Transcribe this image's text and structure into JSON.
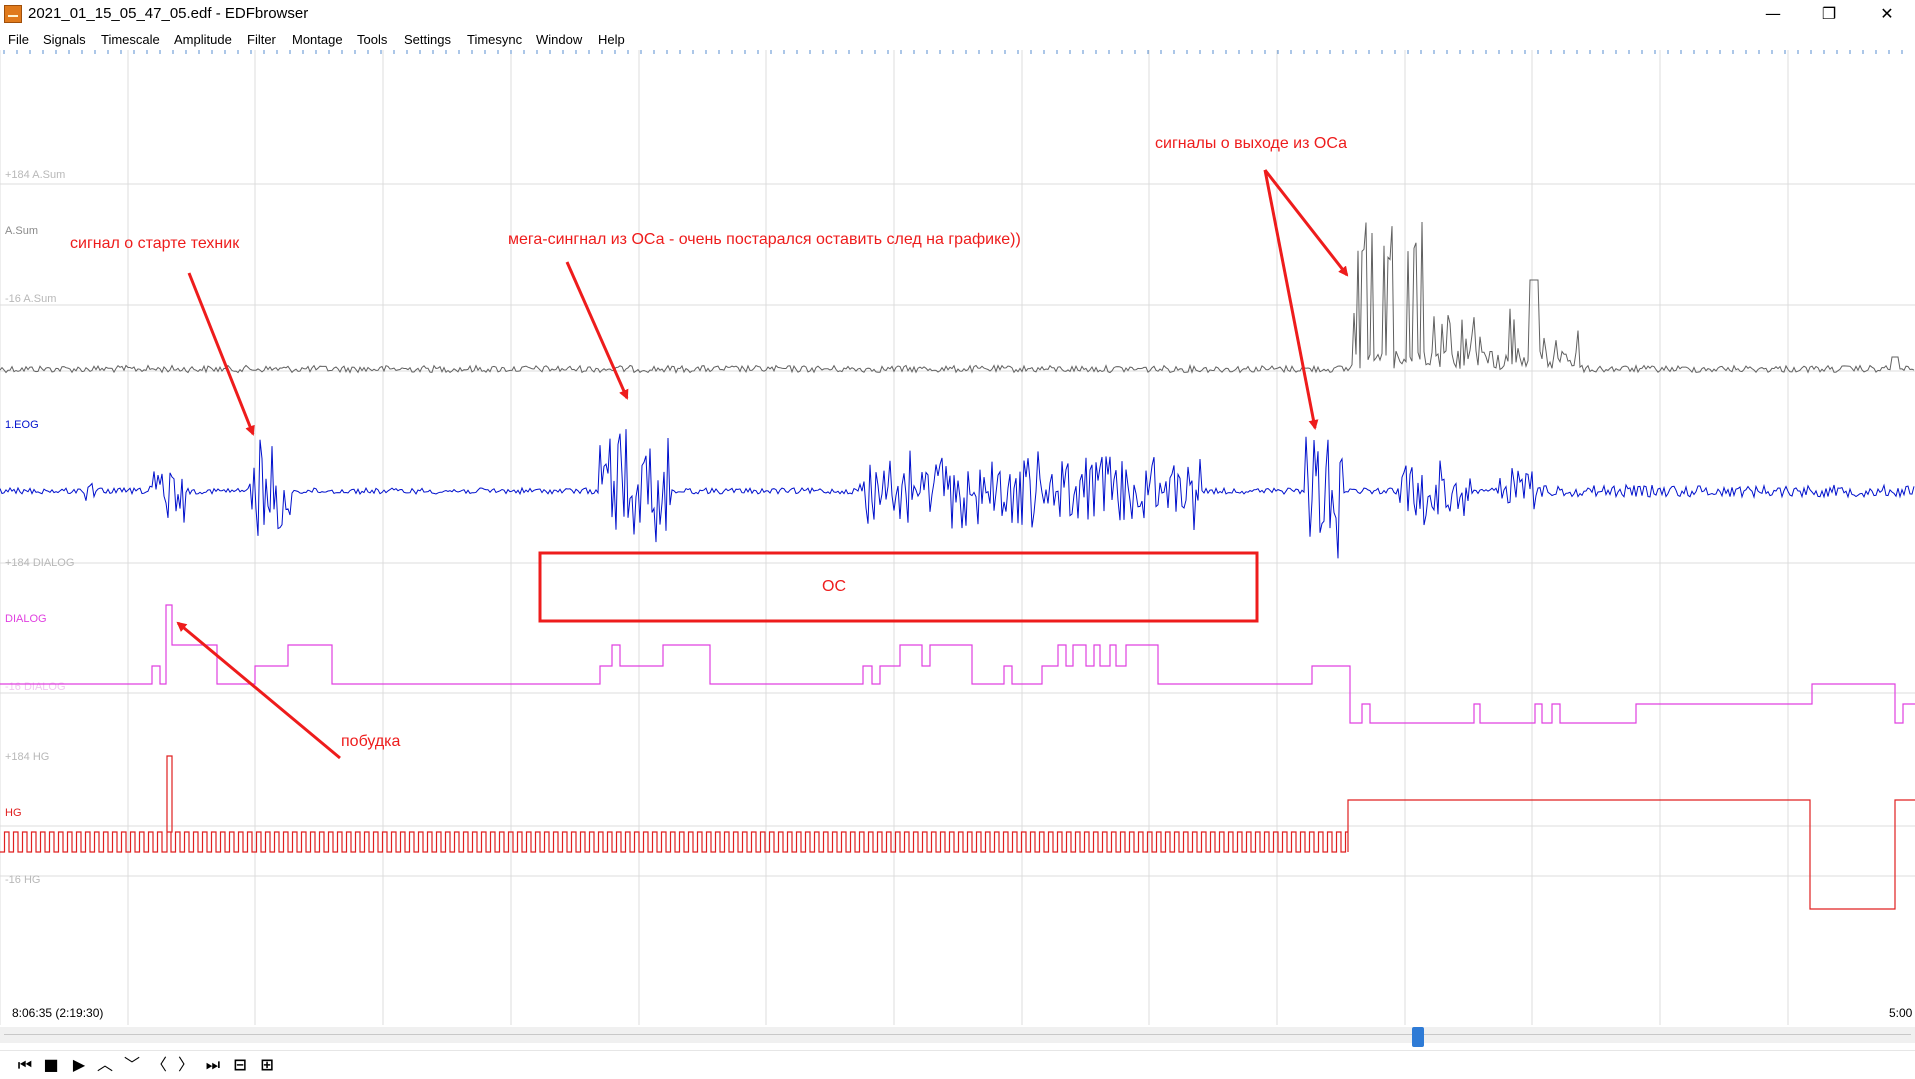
{
  "window": {
    "title": "2021_01_15_05_47_05.edf - EDFbrowser",
    "minimize": "—",
    "maximize": "❐",
    "close": "✕"
  },
  "menu": [
    "File",
    "Signals",
    "Timescale",
    "Amplitude",
    "Filter",
    "Montage",
    "Tools",
    "Settings",
    "Timesync",
    "Window",
    "Help"
  ],
  "signals": {
    "asum": {
      "label": "A.Sum",
      "top": "+184 A.Sum",
      "bottom": "-16 A.Sum",
      "color": "#606060"
    },
    "eog": {
      "label": "1.EOG",
      "color": "#0010cc"
    },
    "dialog": {
      "label": "DIALOG",
      "top": "+184 DIALOG",
      "bottom": "-16 DIALOG",
      "color": "#e040e0"
    },
    "hg": {
      "label": "HG",
      "top": "+184 HG",
      "bottom": "-16 HG",
      "color": "#e02020"
    }
  },
  "annotations": {
    "technique_start": "сигнал о старте техник",
    "mega_signal": "мега-сингнал из ОСа - очень постарался оставить след на графике))",
    "exit_signals": "сигналы о выходе из ОСа",
    "wakeup": "побудка",
    "box_label": "ОС",
    "color": "#ee1c1c"
  },
  "status": {
    "left_time": "8:06:35 (2:19:30)",
    "right_time": "5:00"
  },
  "scroll": {
    "position_fraction": 0.742
  },
  "toolbar": {
    "first": "⏮",
    "stop": "■",
    "play": "▶",
    "up": "︿",
    "down": "﹀",
    "prev": "〈",
    "next": "〉",
    "last": "⏭",
    "zoom_out": "⊟",
    "zoom_in": "⊞"
  }
}
